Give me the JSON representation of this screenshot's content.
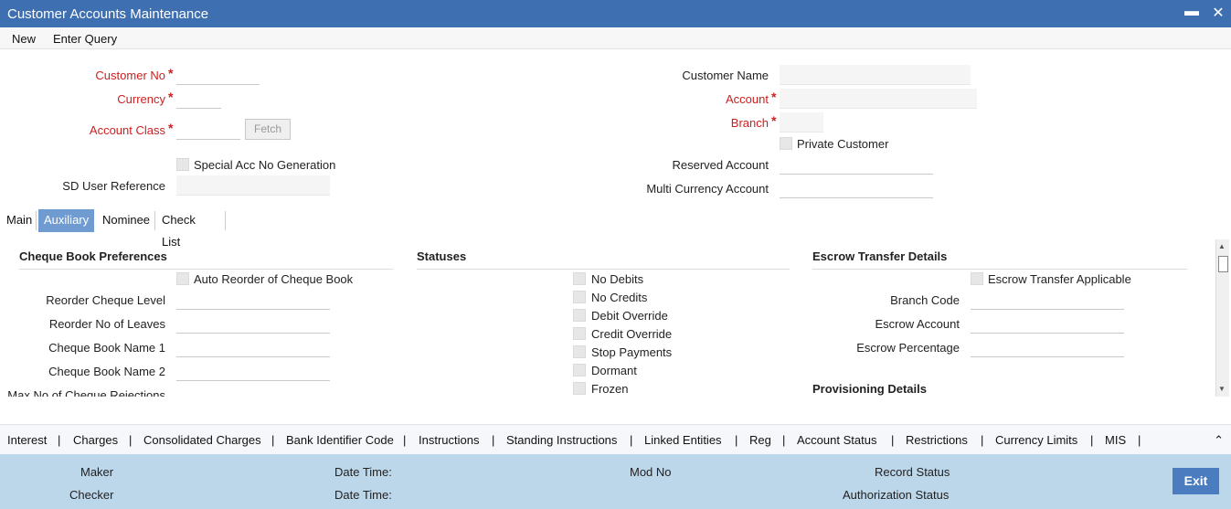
{
  "window": {
    "title": "Customer Accounts Maintenance",
    "minimize": "▬",
    "close": "✕"
  },
  "toolbar": {
    "new": "New",
    "enter_query": "Enter Query"
  },
  "header_form": {
    "customer_no": "Customer No",
    "currency": "Currency",
    "account_class": "Account Class",
    "fetch": "Fetch",
    "special_acc": "Special Acc No Generation",
    "sd_user_ref": "SD User Reference",
    "customer_name": "Customer Name",
    "account": "Account",
    "branch": "Branch",
    "private_customer": "Private Customer",
    "reserved_account": "Reserved Account",
    "multi_currency_account": "Multi Currency Account",
    "required_mark": "*"
  },
  "tabs": [
    "Main",
    "Auxiliary",
    "Nominee",
    "Check List"
  ],
  "active_tab": "Auxiliary",
  "cheque": {
    "heading": "Cheque Book Preferences",
    "auto_reorder": "Auto Reorder of Cheque Book",
    "reorder_level": "Reorder Cheque Level",
    "reorder_leaves": "Reorder No of Leaves",
    "book_name1": "Cheque Book Name 1",
    "book_name2": "Cheque Book Name 2",
    "max_rejections": "Max No of Cheque Rejections"
  },
  "statuses": {
    "heading": "Statuses",
    "items": [
      "No Debits",
      "No Credits",
      "Debit Override",
      "Credit Override",
      "Stop Payments",
      "Dormant",
      "Frozen"
    ]
  },
  "escrow": {
    "heading": "Escrow Transfer Details",
    "applicable": "Escrow Transfer Applicable",
    "branch_code": "Branch Code",
    "escrow_account": "Escrow Account",
    "escrow_percentage": "Escrow Percentage",
    "provisioning": "Provisioning Details"
  },
  "bottom_links": [
    "Interest",
    "Charges",
    "Consolidated Charges",
    "Bank Identifier Code",
    "Instructions",
    "Standing Instructions",
    "Linked Entities",
    "Reg",
    "Account Status",
    "Restrictions",
    "Currency Limits",
    "MIS"
  ],
  "bottom_sep": "|",
  "footer": {
    "maker": "Maker",
    "checker": "Checker",
    "date_time": "Date Time:",
    "mod_no": "Mod No",
    "record_status": "Record Status",
    "authorization_status": "Authorization Status",
    "exit": "Exit"
  },
  "colors": {
    "title_bar": "#3e6fb1",
    "required": "#cc1f1f",
    "active_tab": "#6f9bd0",
    "footer": "#bcd6ea"
  }
}
